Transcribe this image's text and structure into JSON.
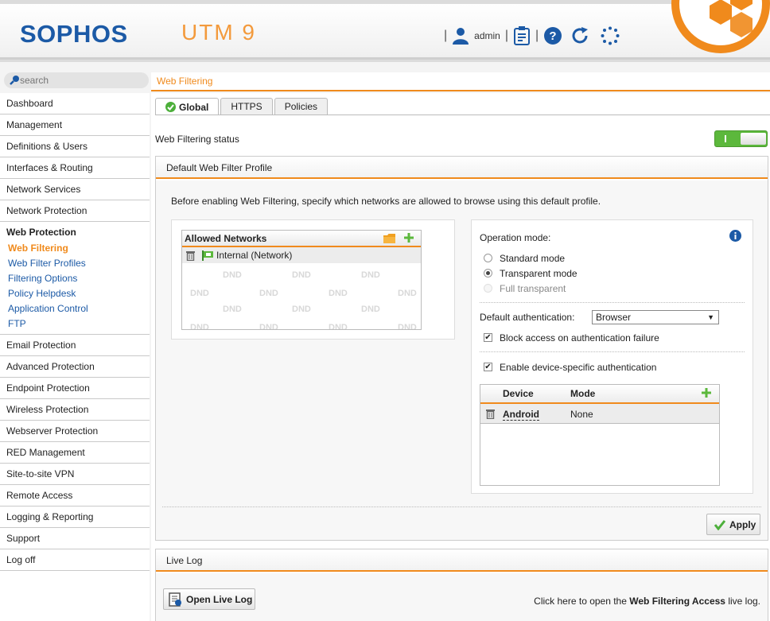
{
  "header": {
    "logo": "SOPHOS",
    "product": "UTM 9",
    "user": "admin"
  },
  "search": {
    "placeholder": "search"
  },
  "breadcrumb": "Web Filtering",
  "sidebar": {
    "items_top": [
      "Dashboard",
      "Management",
      "Definitions & Users",
      "Interfaces & Routing",
      "Network Services",
      "Network Protection"
    ],
    "active": "Web Protection",
    "sub_items": [
      "Web Filtering",
      "Web Filter Profiles",
      "Filtering Options",
      "Policy Helpdesk",
      "Application Control",
      "FTP"
    ],
    "items_bottom": [
      "Email Protection",
      "Advanced Protection",
      "Endpoint Protection",
      "Wireless Protection",
      "Webserver Protection",
      "RED Management",
      "Site-to-site VPN",
      "Remote Access",
      "Logging & Reporting",
      "Support",
      "Log off"
    ]
  },
  "tabs": [
    "Global",
    "HTTPS",
    "Policies"
  ],
  "status": {
    "label": "Web Filtering status",
    "enabled": true
  },
  "profile": {
    "title": "Default Web Filter Profile",
    "intro": "Before enabling Web Filtering, specify which networks are allowed to browse using this default profile.",
    "allowed_networks": {
      "title": "Allowed Networks",
      "items": [
        "Internal (Network)"
      ],
      "dnd": "DND"
    },
    "operation_mode": {
      "label": "Operation mode:",
      "options": [
        "Standard mode",
        "Transparent mode",
        "Full transparent"
      ],
      "selected": "Transparent mode"
    },
    "default_auth": {
      "label": "Default authentication:",
      "value": "Browser"
    },
    "block_access": {
      "label": "Block access on authentication failure",
      "checked": true
    },
    "device_auth": {
      "label": "Enable device-specific authentication",
      "checked": true
    },
    "devices": {
      "columns": [
        "Device",
        "Mode"
      ],
      "rows": [
        {
          "device": "Android",
          "mode": "None"
        }
      ]
    },
    "apply": "Apply"
  },
  "live_log": {
    "title": "Live Log",
    "button": "Open Live Log",
    "hint_prefix": "Click here to open the",
    "hint_bold": "Web Filtering Access",
    "hint_suffix": "live log."
  },
  "colors": {
    "accent": "#f08a1c",
    "brand": "#1c5aa6",
    "toggle_on": "#5cb83c"
  }
}
